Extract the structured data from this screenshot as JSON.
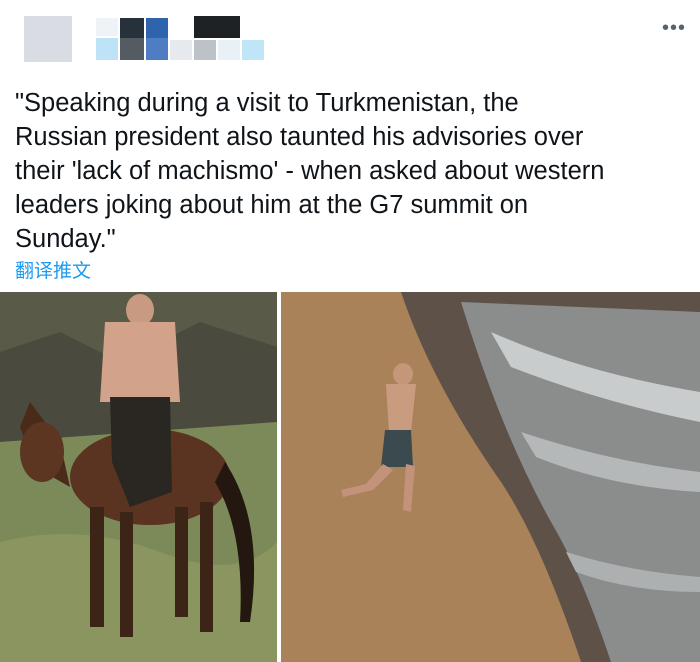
{
  "tweet": {
    "text": "\"Speaking during a visit to Turkmenistan, the\nRussian president also taunted his advisories over\ntheir 'lack of machismo' - when asked about western\nleaders joking about him at the G7 summit on\nSunday.\"",
    "translate_label": "翻译推文",
    "more_icon": "more-options-icon"
  },
  "media": {
    "photos": [
      {
        "subject": "horse-riding-photo"
      },
      {
        "subject": "beach-running-photo"
      }
    ]
  },
  "colors": {
    "link": "#1d9bf0",
    "text": "#0f1419",
    "muted": "#536471"
  }
}
